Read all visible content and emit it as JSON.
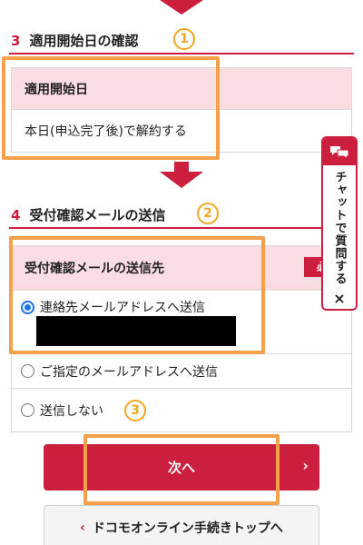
{
  "section3": {
    "number": "3",
    "title": "適用開始日の確認",
    "marker": "1",
    "table_header": "適用開始日",
    "table_value": "本日(申込完了後)で解約する"
  },
  "section4": {
    "number": "4",
    "title": "受付確認メールの送信",
    "marker": "2",
    "table_header": "受付確認メールの送信先",
    "required_label": "必須",
    "options": [
      {
        "label": "連絡先メールアドレスへ送信",
        "selected": true
      },
      {
        "label": "ご指定のメールアドレスへ送信",
        "selected": false
      },
      {
        "label": "送信しない",
        "selected": false
      }
    ],
    "option_marker": "3"
  },
  "chat_tab": {
    "label": "チャットで質問する",
    "close": "×",
    "icon": "chat-bubbles-icon"
  },
  "buttons": {
    "next_label": "次へ",
    "next_chevron": "›",
    "back_label": "ドコモオンライン手続きトップへ",
    "back_chevron": "‹"
  },
  "colors": {
    "accent": "#cc1f3d",
    "annotation": "#f5a04b",
    "header_bg": "#f9dde2"
  }
}
